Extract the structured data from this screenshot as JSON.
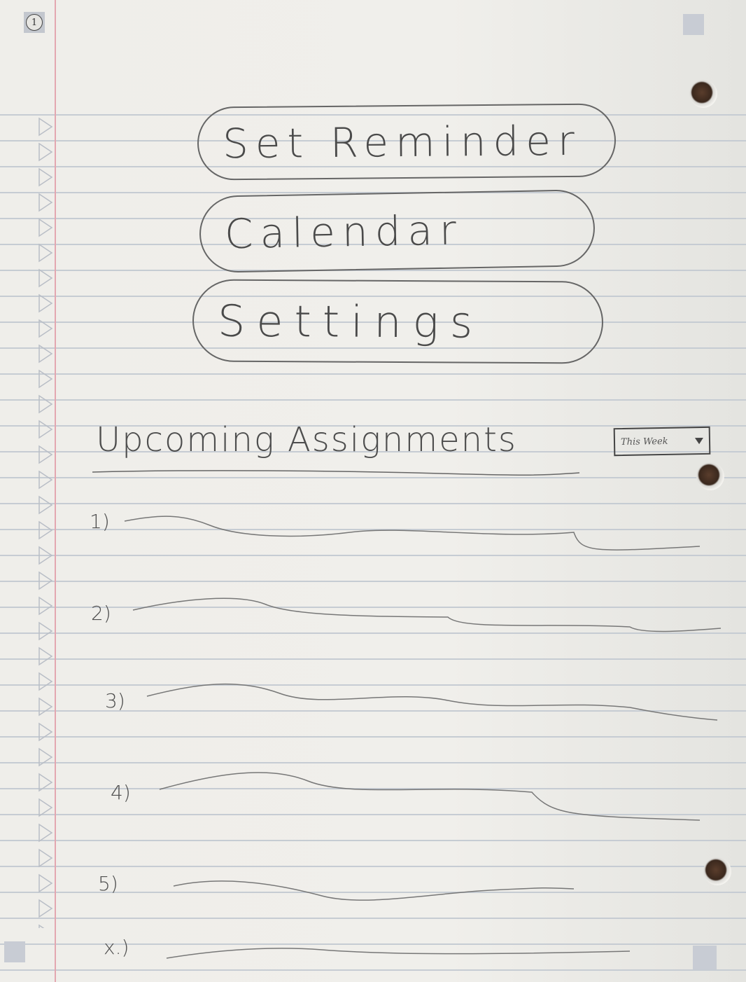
{
  "page": {
    "page_number": "1"
  },
  "menu": {
    "set_reminder_label": "Set Reminder",
    "calendar_label": "Calendar",
    "settings_label": "Settings"
  },
  "assignments": {
    "heading": "Upcoming Assignments",
    "filter_selected": "This Week",
    "items": [
      {
        "number": "1)"
      },
      {
        "number": "2)"
      },
      {
        "number": "3)"
      },
      {
        "number": "4)"
      },
      {
        "number": "5)"
      },
      {
        "number": "x.)"
      }
    ]
  },
  "colors": {
    "ink": "#4a4a4a",
    "ruled_line": "#c6ccd3",
    "margin_line": "#e3a7b0",
    "paper": "#efeeea"
  },
  "icons": {
    "dropdown": "triangle-down-icon",
    "page_number": "circled-number-icon"
  }
}
